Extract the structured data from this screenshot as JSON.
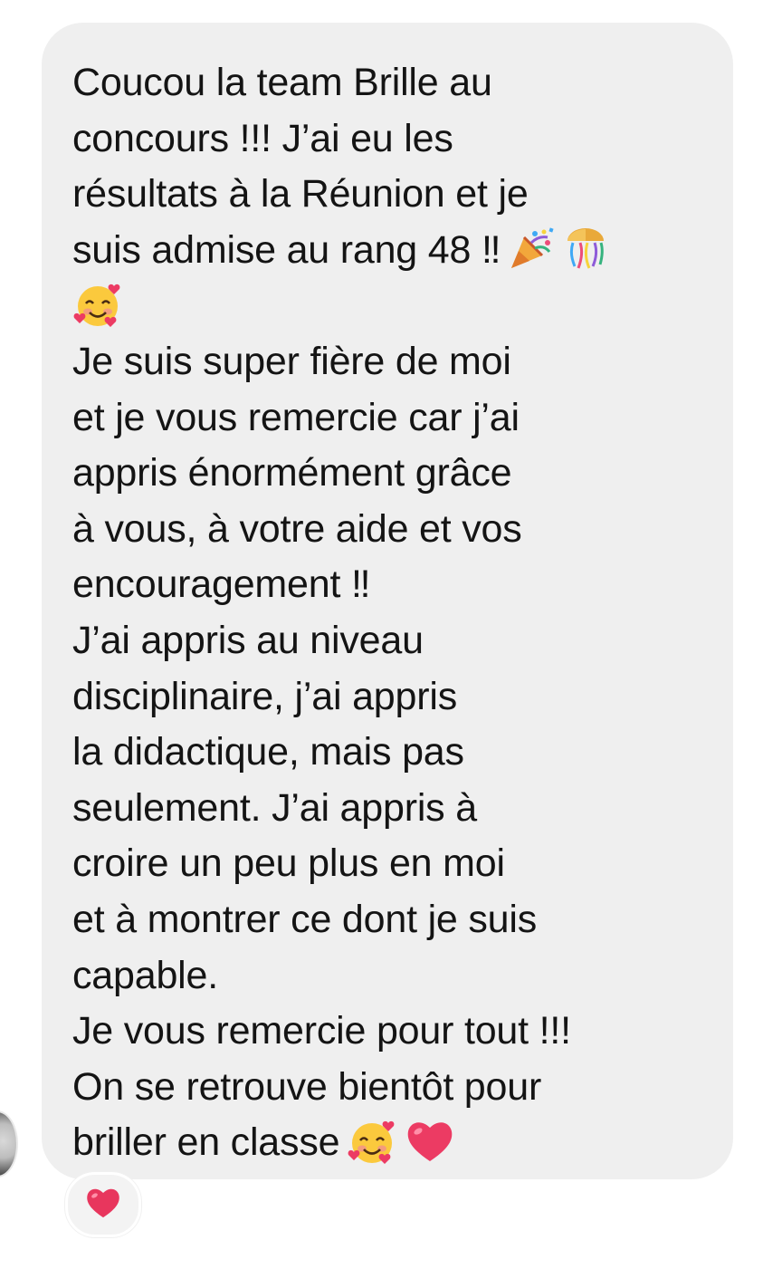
{
  "message": {
    "lines": [
      "Coucou la team Brille au",
      "concours !!! J’ai eu les",
      "résultats à la Réunion et je",
      "suis admise au rang 48 ‼",
      "",
      "Je suis super fière de moi",
      "et je vous remercie car j’ai",
      "appris énormément grâce",
      "à vous, à votre aide et vos",
      "encouragement ‼",
      "J’ai appris au niveau",
      "disciplinaire, j’ai appris",
      "la didactique, mais pas",
      "seulement. J’ai appris à",
      "croire un peu plus en moi",
      "et à montrer ce dont je suis",
      "capable.",
      "Je vous remercie pour tout !!!",
      "On se retrouve bientôt pour",
      "briller en classe"
    ],
    "emojis": {
      "line4": [
        "party-popper-icon",
        "confetti-ball-icon"
      ],
      "line5": [
        "smiling-face-with-hearts-icon"
      ],
      "line20": [
        "smiling-face-with-hearts-icon",
        "red-heart-icon"
      ]
    }
  },
  "reaction": {
    "icon": "red-heart-icon",
    "color": "#e8365d"
  },
  "colors": {
    "bubble": "#efefef",
    "text": "#141414",
    "heart": "#e8365d"
  }
}
